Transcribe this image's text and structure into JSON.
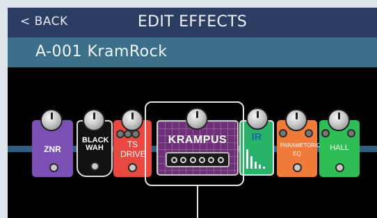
{
  "header": {
    "back_label": "< BACK",
    "title": "EDIT EFFECTS"
  },
  "patch": {
    "name": "A-001 KramRock"
  },
  "effects": [
    {
      "id": "znr",
      "label": "ZNR",
      "color": "#7b4fb4"
    },
    {
      "id": "black-wah",
      "label": "BLACK WAH",
      "color": "#111111"
    },
    {
      "id": "ts-drive",
      "label": "TS DRIVE",
      "color": "#e8483f"
    },
    {
      "id": "krampus",
      "label": "KRAMPUS",
      "color": "#6e2f78",
      "selected": true
    },
    {
      "id": "ir",
      "label": "IR",
      "color": "#29b36a"
    },
    {
      "id": "parametric-eq",
      "label": "PARAMETORIC EQ",
      "color": "#f07a3a"
    },
    {
      "id": "hall",
      "label": "HALL",
      "color": "#2fbd55"
    }
  ],
  "colors": {
    "header_bg": "#2b3d63",
    "patch_bg": "#3c6f8a",
    "stage_bg": "#000000",
    "cable": "#2f5f80"
  }
}
